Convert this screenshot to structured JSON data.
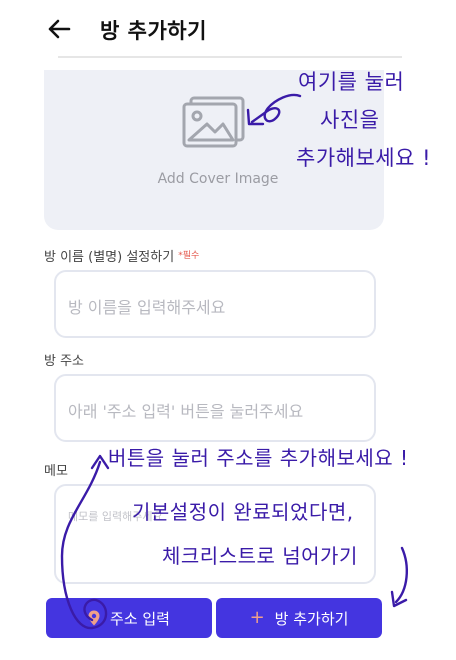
{
  "header": {
    "title": "방 추가하기",
    "back_icon": "arrow-left-icon"
  },
  "cover": {
    "label": "Add Cover Image",
    "icon": "image-icon"
  },
  "name_field": {
    "label": "방 이름 (별명) 설정하기",
    "required": "*필수",
    "placeholder": "방 이름을 입력해주세요"
  },
  "address_field": {
    "label": "방 주소",
    "placeholder": "아래 '주소 입력' 버튼을 눌러주세요"
  },
  "memo_field": {
    "label": "메모",
    "placeholder": "메모를 입력해주세요"
  },
  "buttons": {
    "address": "주소 입력",
    "add": "방 추가하기",
    "add_plus": "+"
  },
  "annotations": {
    "cover_1": "여기를 눌러",
    "cover_2": "사진을",
    "cover_3": "추가해보세요 !",
    "button_note": "버튼을 눌러 주소를 추가해보세요 !",
    "next_1": "기본설정이 완료되었다면,",
    "next_2": "체크리스트로 넘어가기"
  },
  "colors": {
    "accent": "#4435e0",
    "annotation": "#3a1ba8",
    "required": "#e4574b"
  }
}
